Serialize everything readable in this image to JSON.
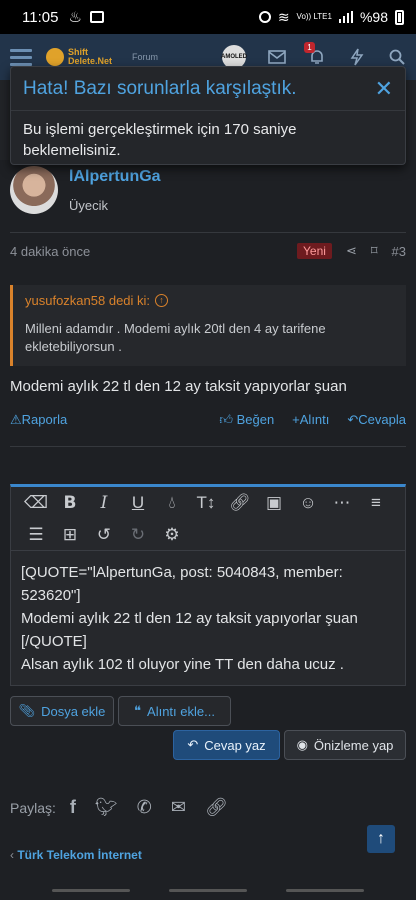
{
  "status": {
    "time": "11:05",
    "signal_label": "Vo)) LTE1",
    "battery": "%98"
  },
  "nav": {
    "logo_line1": "Shift",
    "logo_line2": "Delete.Net",
    "forum_link": "Forum",
    "amoled_label": "AMOLED",
    "alerts_count": "1"
  },
  "alert": {
    "title": "Hata! Bazı sorunlarla karşılaştık.",
    "message": "Bu işlemi gerçekleştirmek için 170 saniye beklemelisiniz."
  },
  "post": {
    "username": "lAlpertunGa",
    "user_title": "Üyecik",
    "time_ago": "4 dakika önce",
    "new_label": "Yeni",
    "post_number": "#3",
    "quote_author": "yusufozkan58 dedi ki:",
    "quote_text": "Milleni adamdır . Modemi aylık 20tl den 4 ay tarifene ekletebiliyorsun .",
    "body": "Modemi aylık 22 tl den 12 ay taksit yapıyorlar şuan"
  },
  "actions": {
    "report": "Raporla",
    "like": "Beğen",
    "quote": "Alıntı",
    "reply": "Cevapla"
  },
  "editor": {
    "line1": "[QUOTE=\"lAlpertunGa, post: 5040843, member: 523620\"]",
    "line2": "Modemi aylık 22 tl den 12 ay taksit yapıyorlar şuan",
    "line3": "[/QUOTE]",
    "line4": "Alsan aylık 102 tl oluyor yine TT den daha ucuz ."
  },
  "buttons": {
    "attach": "Dosya ekle",
    "insert_quote": "Alıntı ekle...",
    "post_reply": "Cevap yaz",
    "preview": "Önizleme yap"
  },
  "share": {
    "label": "Paylaş:"
  },
  "breadcrumb": {
    "label": "Türk Telekom İnternet"
  },
  "colors": {
    "accent": "#4fa3e0",
    "quote_border": "#d9822b",
    "background": "#1e2024"
  }
}
